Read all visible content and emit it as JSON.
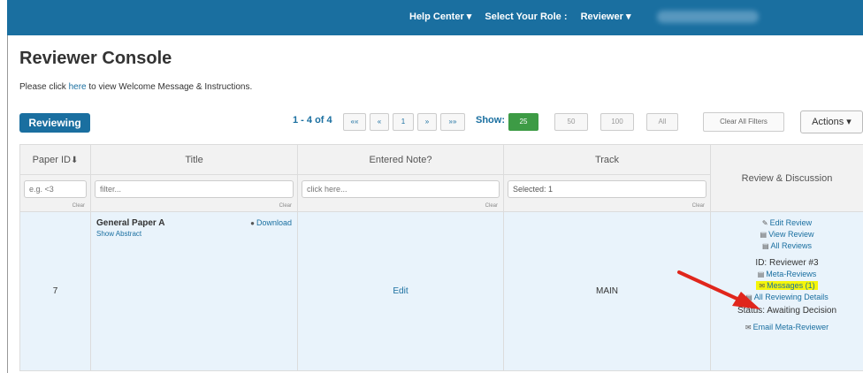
{
  "topbar": {
    "help_center": "Help Center ▾",
    "select_role_label": "Select Your Role :",
    "role_value": "Reviewer ▾"
  },
  "page": {
    "title": "Reviewer Console",
    "welcome_pre": "Please click ",
    "welcome_link": "here",
    "welcome_post": " to view Welcome Message & Instructions."
  },
  "toolbar": {
    "tab_label": "Reviewing",
    "pager_info": "1 - 4 of 4",
    "first": "««",
    "prev": "«",
    "page": "1",
    "next": "»",
    "last": "»»",
    "show_label": "Show:",
    "page_sizes": [
      "25",
      "50",
      "100",
      "All"
    ],
    "selected_page_size": "25",
    "clear_filters": "Clear All Filters",
    "actions": "Actions ▾"
  },
  "table": {
    "headers": {
      "paper_id": "Paper ID",
      "paper_id_sort": "⬇",
      "title": "Title",
      "entered_note": "Entered Note?",
      "track": "Track",
      "review_discussion": "Review & Discussion"
    },
    "filters": {
      "paper_id_placeholder": "e.g. <3",
      "title_placeholder": "filter...",
      "note_placeholder": "click here...",
      "track_value": "Selected: 1",
      "clear": "Clear"
    },
    "row": {
      "paper_id": "7",
      "paper_title": "General Paper A",
      "show_abstract": "Show Abstract",
      "download": "Download",
      "note": "Edit",
      "track": "MAIN",
      "edit_review": "Edit Review",
      "view_review": "View Review",
      "all_reviews": "All Reviews",
      "reviewer_id": "ID: Reviewer #3",
      "meta_reviews": "Meta-Reviews",
      "messages": "Messages (1)",
      "all_reviewing_details": "All Reviewing Details",
      "status": "Status: Awaiting Decision",
      "email_meta_reviewer": "Email Meta-Reviewer"
    }
  },
  "colors": {
    "brand": "#1a6fa0",
    "active_green": "#3d9b45",
    "row_bg": "#e9f3fb",
    "highlight": "#f5f50a",
    "arrow": "#e0261c"
  }
}
